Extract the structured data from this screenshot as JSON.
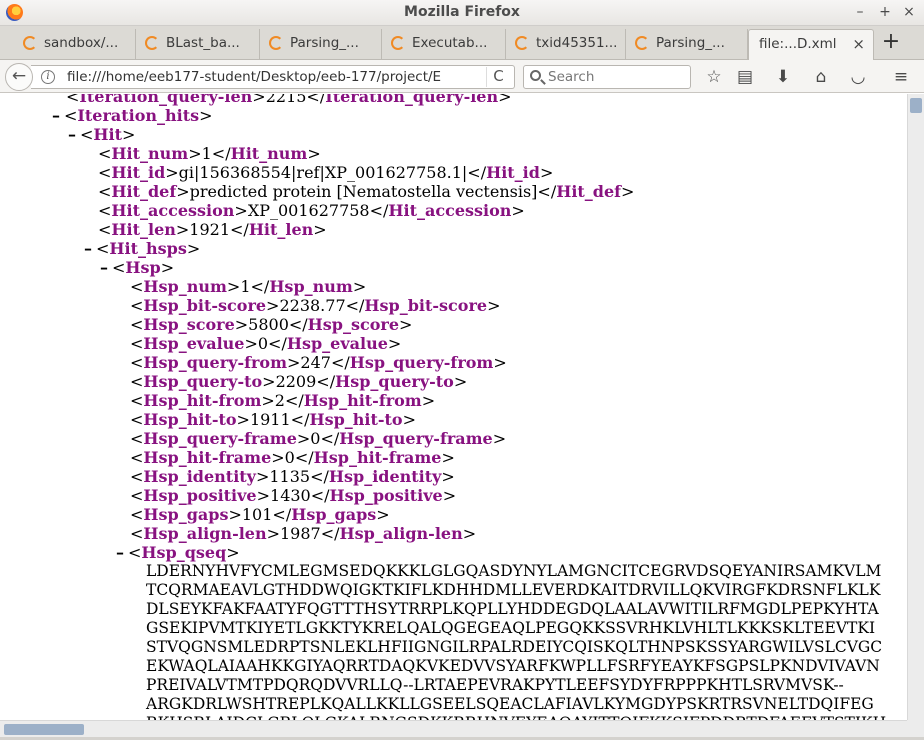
{
  "window": {
    "title": "Mozilla Firefox",
    "minimize": "–",
    "maximize": "+",
    "close": "×"
  },
  "tabs": [
    {
      "label": "sandbox/..."
    },
    {
      "label": "BLast_ba..."
    },
    {
      "label": "Parsing_..."
    },
    {
      "label": "Executab..."
    },
    {
      "label": "txid45351..."
    },
    {
      "label": "Parsing_..."
    },
    {
      "label": "file:...D.xml",
      "active": true
    }
  ],
  "tab_close": "×",
  "new_tab": "+",
  "nav": {
    "back": "←",
    "info": "i",
    "url": "file:///home/eeb177-student/Desktop/eeb-177/project/E",
    "reload": "C",
    "search_placeholder": "Search",
    "icons": [
      "star-icon",
      "reading-list-icon",
      "download-icon",
      "home-icon",
      "pocket-icon",
      "menu-icon"
    ],
    "glyphs": {
      "star": "☆",
      "reading": "▤",
      "download": "⬇",
      "home": "⌂",
      "pocket": "◡",
      "menu": "≡"
    }
  },
  "xml": {
    "lines": [
      {
        "indent": 0,
        "toggle": "",
        "open": "Iteration_query-len",
        "text": "2215",
        "close": "Iteration_query-len"
      },
      {
        "indent": 0,
        "toggle": "–",
        "open": "Iteration_hits",
        "text": "",
        "close": ""
      },
      {
        "indent": 1,
        "toggle": "–",
        "open": "Hit",
        "text": "",
        "close": ""
      },
      {
        "indent": 2,
        "toggle": "",
        "open": "Hit_num",
        "text": "1",
        "close": "Hit_num"
      },
      {
        "indent": 2,
        "toggle": "",
        "open": "Hit_id",
        "text": "gi|156368554|ref|XP_001627758.1|",
        "close": "Hit_id"
      },
      {
        "indent": 2,
        "toggle": "",
        "open": "Hit_def",
        "text": "predicted protein [Nematostella vectensis]",
        "close": "Hit_def"
      },
      {
        "indent": 2,
        "toggle": "",
        "open": "Hit_accession",
        "text": "XP_001627758",
        "close": "Hit_accession"
      },
      {
        "indent": 2,
        "toggle": "",
        "open": "Hit_len",
        "text": "1921",
        "close": "Hit_len"
      },
      {
        "indent": 2,
        "toggle": "–",
        "open": "Hit_hsps",
        "text": "",
        "close": ""
      },
      {
        "indent": 3,
        "toggle": "–",
        "open": "Hsp",
        "text": "",
        "close": ""
      },
      {
        "indent": 4,
        "toggle": "",
        "open": "Hsp_num",
        "text": "1",
        "close": "Hsp_num"
      },
      {
        "indent": 4,
        "toggle": "",
        "open": "Hsp_bit-score",
        "text": "2238.77",
        "close": "Hsp_bit-score"
      },
      {
        "indent": 4,
        "toggle": "",
        "open": "Hsp_score",
        "text": "5800",
        "close": "Hsp_score"
      },
      {
        "indent": 4,
        "toggle": "",
        "open": "Hsp_evalue",
        "text": "0",
        "close": "Hsp_evalue"
      },
      {
        "indent": 4,
        "toggle": "",
        "open": "Hsp_query-from",
        "text": "247",
        "close": "Hsp_query-from"
      },
      {
        "indent": 4,
        "toggle": "",
        "open": "Hsp_query-to",
        "text": "2209",
        "close": "Hsp_query-to"
      },
      {
        "indent": 4,
        "toggle": "",
        "open": "Hsp_hit-from",
        "text": "2",
        "close": "Hsp_hit-from"
      },
      {
        "indent": 4,
        "toggle": "",
        "open": "Hsp_hit-to",
        "text": "1911",
        "close": "Hsp_hit-to"
      },
      {
        "indent": 4,
        "toggle": "",
        "open": "Hsp_query-frame",
        "text": "0",
        "close": "Hsp_query-frame"
      },
      {
        "indent": 4,
        "toggle": "",
        "open": "Hsp_hit-frame",
        "text": "0",
        "close": "Hsp_hit-frame"
      },
      {
        "indent": 4,
        "toggle": "",
        "open": "Hsp_identity",
        "text": "1135",
        "close": "Hsp_identity"
      },
      {
        "indent": 4,
        "toggle": "",
        "open": "Hsp_positive",
        "text": "1430",
        "close": "Hsp_positive"
      },
      {
        "indent": 4,
        "toggle": "",
        "open": "Hsp_gaps",
        "text": "101",
        "close": "Hsp_gaps"
      },
      {
        "indent": 4,
        "toggle": "",
        "open": "Hsp_align-len",
        "text": "1987",
        "close": "Hsp_align-len"
      },
      {
        "indent": 4,
        "toggle": "–",
        "open": "Hsp_qseq",
        "text": "",
        "close": ""
      }
    ],
    "qseq_lines": [
      "LDERNYHVFYCMLEGMSEDQKKKLGLGQASDYNYLAMGNCITCEGRVDSQEYANIRSAMKVLM",
      "TCQRMAEAVLGTHDDWQIGKTKIFLKDHHDMLLEVERDKAITDRVILLQKVIRGFKDRSNFLKLK",
      "DLSEYKFAKFAATYFQGTTTHSYTRRPLKQPLLYHDDEGDQLAALAVWITILRFMGDLPEPKYHTA",
      "GSEKIPVMTKIYETLGKKTYKRELQALQGEGEAQLPEGQKKSSVRHKLVHLTLKKKSKLTEEVTKI",
      "STVQGNSMLEDRPTSNLEKLHFIIGNGILRPALRDEIYCQISKQLTHNPSKSSYARGWILVSLCVGC",
      "EKWAQLAIAAHKKGIYAQRRTDAQKVKEDVVSYARFKWPLLFSRFYEAYKFSGPSLPKNDVIVAVN",
      "PREIVALVTMTPDQRQDVVRLLQ--LRTAEPEVRAKPYTLEEFSYDYFRPPPKHTLSRVMVSK--",
      "ARGKDRLWSHTREPLKQALLKKLLGSEELSQEACLAFIAVLKYMGDYPSKRTRSVNELTDQIFEG",
      "RKHSRLAIDCLGRLQLGKALRNGSDKKRRHNVEYEAQAYITTQIFKKSIFPDDRTDFAEEVTSTIKH"
    ]
  }
}
